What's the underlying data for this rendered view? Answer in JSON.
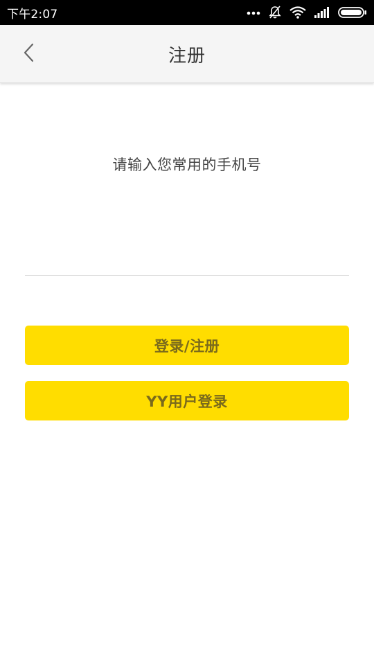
{
  "status_bar": {
    "time": "下午2:07",
    "icons": [
      "more-dots-icon",
      "bell-off-icon",
      "wifi-icon",
      "signal-icon",
      "battery-icon"
    ]
  },
  "header": {
    "title": "注册",
    "back_icon": "chevron-left-icon"
  },
  "main": {
    "prompt": "请输入您常用的手机号",
    "phone_input": {
      "value": "",
      "placeholder": ""
    },
    "login_register_button": "登录/注册",
    "yy_login_button": "YY用户登录"
  },
  "colors": {
    "status_bar_bg": "#000000",
    "header_bg": "#f5f5f5",
    "button_bg": "#ffdd00",
    "button_text": "#7a6a1c"
  }
}
